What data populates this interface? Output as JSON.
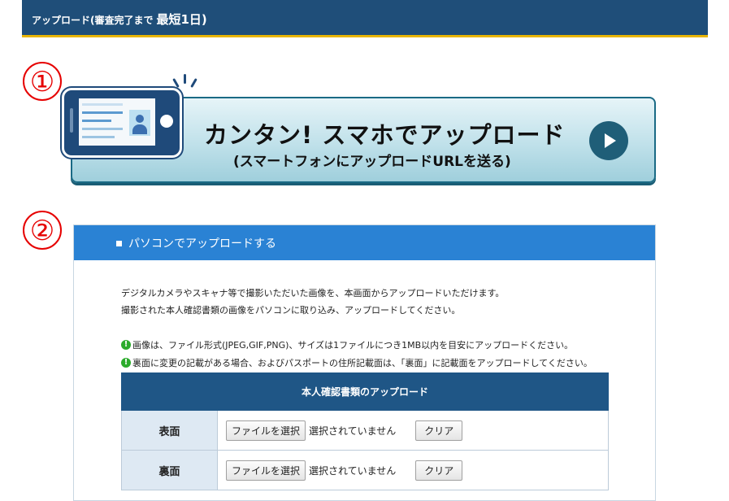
{
  "header": {
    "title": "アップロード(審査完了まで",
    "emphasis": "最短1日)"
  },
  "steps": {
    "step1": "①",
    "step2": "②"
  },
  "smartphone_banner": {
    "title": "カンタン! スマホでアップロード",
    "subtitle": "(スマートフォンにアップロードURLを送る)",
    "play_icon": "play-circle-icon"
  },
  "pc_upload": {
    "title": "パソコンでアップロードする",
    "description": [
      "デジタルカメラやスキャナ等で撮影いただいた画像を、本画面からアップロードいただけます。",
      "撮影された本人確認書類の画像をパソコンに取り込み、アップロードしてください。"
    ],
    "notes": [
      "画像は、ファイル形式(JPEG,GIF,PNG)、サイズは1ファイルにつき1MB以内を目安にアップロードください。",
      "裏面に変更の記載がある場合、およびパスポートの住所記載面は、「裏面」に記載面をアップロードしてください。"
    ],
    "table": {
      "caption": "本人確認書類のアップロード",
      "rows": [
        {
          "label": "表面",
          "file_button": "ファイルを選択",
          "file_status": "選択されていません",
          "clear_button": "クリア"
        },
        {
          "label": "裏面",
          "file_button": "ファイルを選択",
          "file_status": "選択されていません",
          "clear_button": "クリア"
        }
      ]
    }
  },
  "colors": {
    "header_bg": "#1f4e79",
    "header_accent": "#e8b400",
    "step_red": "#e60000",
    "panel_header": "#2a82d4",
    "table_header": "#1f5686",
    "check_green": "#2bab2b"
  }
}
